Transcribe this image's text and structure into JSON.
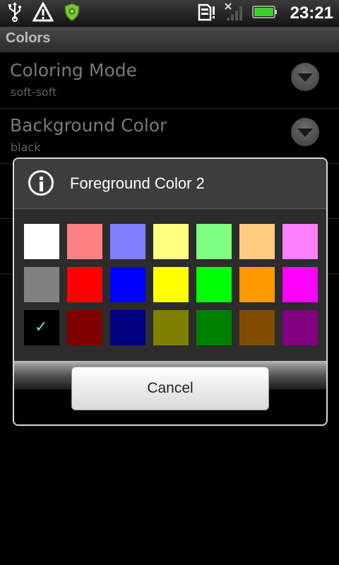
{
  "status_bar": {
    "time": "23:21",
    "icons": [
      "usb-icon",
      "warning-icon",
      "shield-icon",
      "sd-card-icon",
      "no-signal-icon",
      "battery-icon"
    ]
  },
  "app": {
    "title": "Colors"
  },
  "preferences": [
    {
      "title": "Coloring Mode",
      "summary": "soft-soft"
    },
    {
      "title": "Background Color",
      "summary": "black"
    }
  ],
  "dialog": {
    "title": "Foreground Color 2",
    "cancel_label": "Cancel",
    "selected_color": "#000000",
    "colors": [
      "#ffffff",
      "#ff8080",
      "#8080ff",
      "#ffff80",
      "#80ff80",
      "#ffcc80",
      "#ff80ff",
      "#808080",
      "#ff0000",
      "#0000ff",
      "#ffff00",
      "#00ff00",
      "#ff9900",
      "#ff00ff",
      "#000000",
      "#800000",
      "#000080",
      "#808000",
      "#008000",
      "#804d00",
      "#800080"
    ],
    "check_glyph": "✓"
  }
}
